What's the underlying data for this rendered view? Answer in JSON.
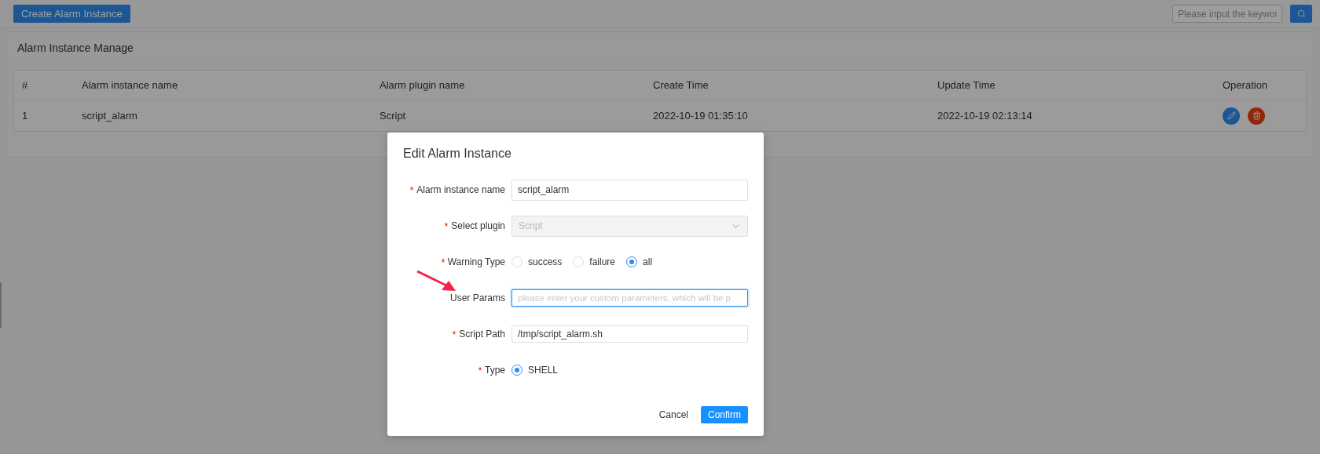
{
  "toolbar": {
    "create_button": "Create Alarm Instance",
    "search": {
      "placeholder": "Please input the keywor"
    }
  },
  "card": {
    "title": "Alarm Instance Manage",
    "table": {
      "columns": [
        "#",
        "Alarm instance name",
        "Alarm plugin name",
        "Create Time",
        "Update Time",
        "Operation"
      ],
      "rows": [
        {
          "cells": [
            "1",
            "script_alarm",
            "Script",
            "2022-10-19 01:35:10",
            "2022-10-19 02:13:14"
          ]
        }
      ]
    }
  },
  "dialog": {
    "title": "Edit Alarm Instance",
    "fields": [
      {
        "kind": "text",
        "label": "Alarm instance name",
        "required": true,
        "value": "script_alarm"
      },
      {
        "kind": "select",
        "label": "Select plugin",
        "required": true,
        "value": "Script",
        "disabled": true
      },
      {
        "kind": "radio",
        "label": "Warning Type",
        "required": true,
        "options": [
          {
            "label": "success",
            "selected": false
          },
          {
            "label": "failure",
            "selected": false
          },
          {
            "label": "all",
            "selected": true
          }
        ]
      },
      {
        "kind": "text",
        "label": "User Params",
        "required": false,
        "placeholder": "please enter your custom parameters, which will be p",
        "focused": true
      },
      {
        "kind": "text",
        "label": "Script Path",
        "required": true,
        "value": "/tmp/script_alarm.sh"
      },
      {
        "kind": "radio",
        "label": "Type",
        "required": true,
        "options": [
          {
            "label": "SHELL",
            "selected": true
          }
        ]
      }
    ],
    "buttons": {
      "cancel": "Cancel",
      "confirm": "Confirm"
    }
  }
}
